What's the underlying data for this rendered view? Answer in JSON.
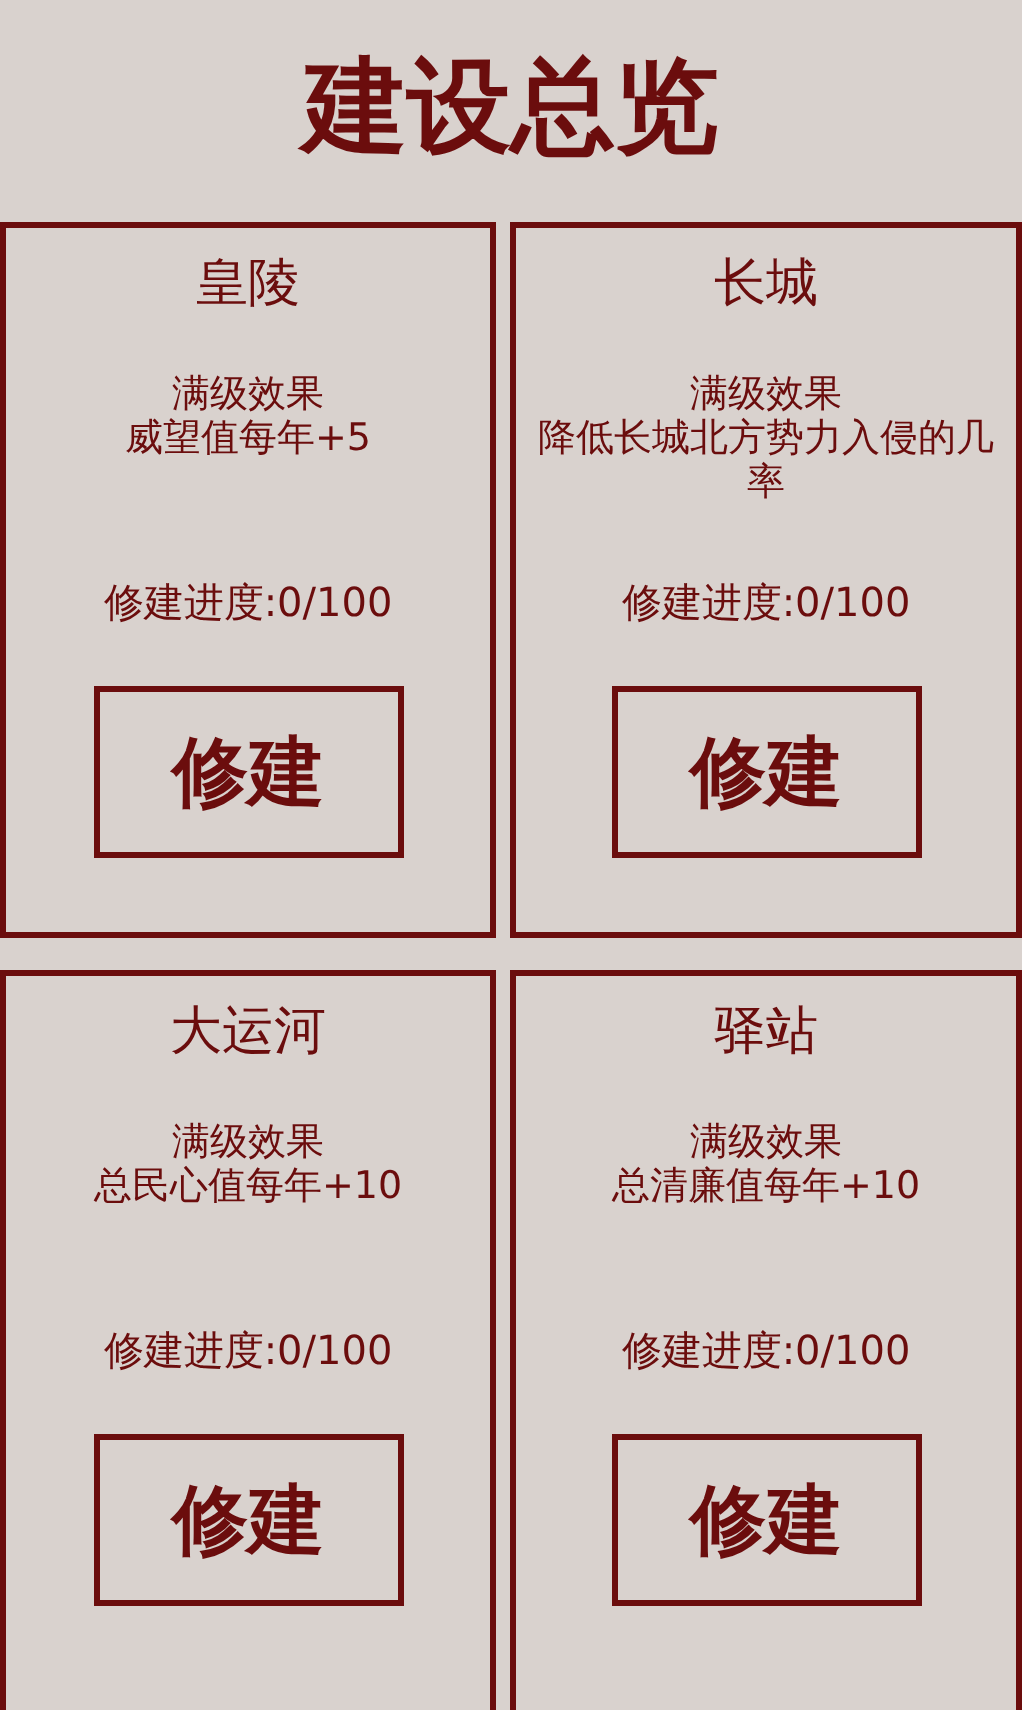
{
  "title": "建设总览",
  "buildings": [
    {
      "name": "皇陵",
      "effect_label": "满级效果",
      "effect": "威望值每年+5",
      "progress": "修建进度:0/100",
      "button": "修建"
    },
    {
      "name": "长城",
      "effect_label": "满级效果",
      "effect": "降低长城北方势力入侵的几率",
      "progress": "修建进度:0/100",
      "button": "修建"
    },
    {
      "name": "大运河",
      "effect_label": "满级效果",
      "effect": "总民心值每年+10",
      "progress": "修建进度:0/100",
      "button": "修建"
    },
    {
      "name": "驿站",
      "effect_label": "满级效果",
      "effect": "总清廉值每年+10",
      "progress": "修建进度:0/100",
      "button": "修建"
    }
  ]
}
